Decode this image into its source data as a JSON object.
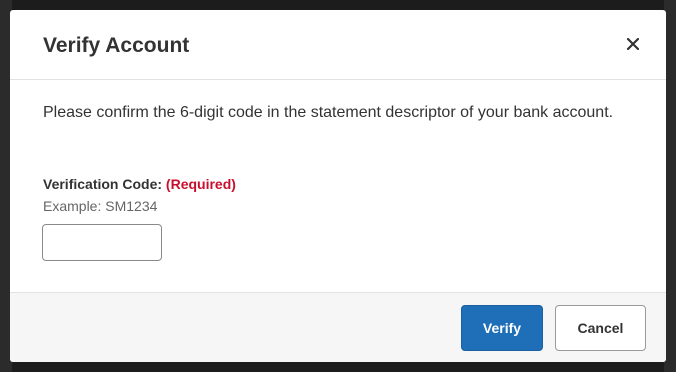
{
  "dialog": {
    "title": "Verify Account",
    "close_icon": "close-icon"
  },
  "body": {
    "description": "Please confirm the 6-digit code in the statement descriptor of your bank account.",
    "field": {
      "label": "Verification Code:",
      "required_text": "(Required)",
      "hint": "Example: SM1234",
      "value": "",
      "required_color": "#c8102e"
    }
  },
  "footer": {
    "verify_label": "Verify",
    "cancel_label": "Cancel",
    "verify_color": "#1f6fb8"
  }
}
